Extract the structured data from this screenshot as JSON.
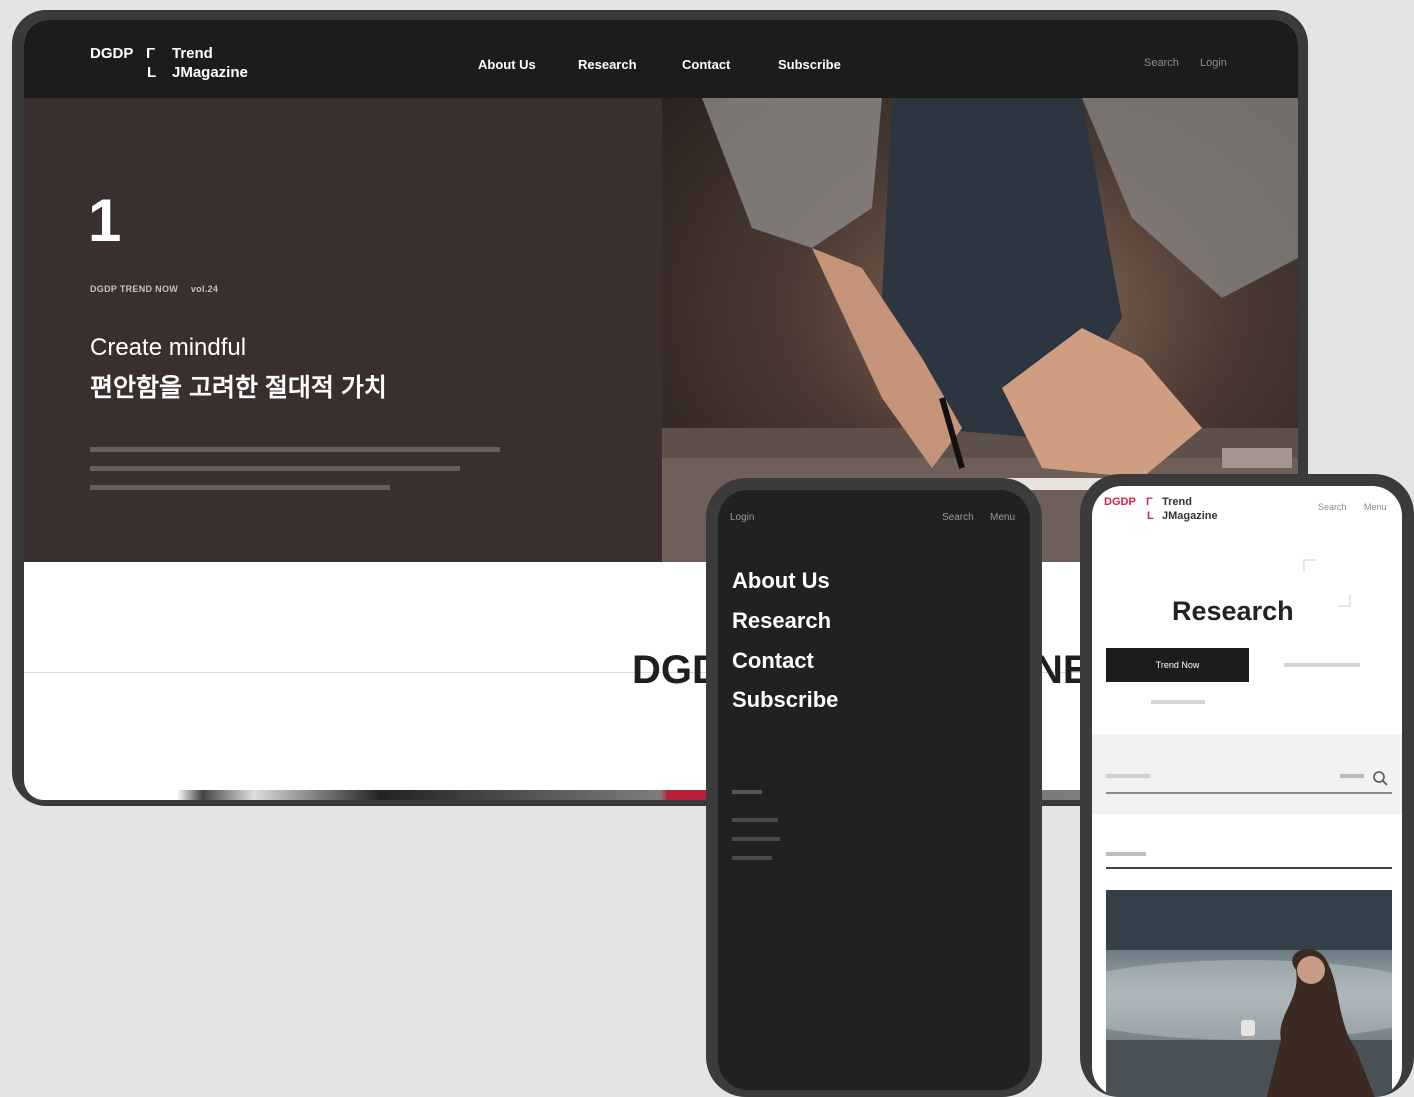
{
  "desktop": {
    "header": {
      "logo_left": "DGDP",
      "logo_bracket_open": "Γ",
      "logo_bracket_close": "L",
      "logo_line1": "Trend",
      "logo_line2": "JMagazine",
      "nav": [
        "About Us",
        "Research",
        "Contact",
        "Subscribe"
      ],
      "search": "Search",
      "login": "Login"
    },
    "hero": {
      "number": "1",
      "kicker": "DGDP TREND NOW",
      "volume": "vol.24",
      "title_en": "Create mindful",
      "title_ko": "편안함을 고려한 절대적 가치"
    },
    "section_word_left": "DGD",
    "section_word_right": "NE"
  },
  "phone_menu": {
    "login": "Login",
    "search": "Search",
    "menu": "Menu",
    "items": [
      "About Us",
      "Research",
      "Contact",
      "Subscribe"
    ]
  },
  "phone_research": {
    "logo_left": "DGDP",
    "logo_bracket_open": "Γ",
    "logo_bracket_close": "L",
    "logo_line1": "Trend",
    "logo_line2": "JMagazine",
    "search": "Search",
    "menu": "Menu",
    "title": "Research",
    "tab_active": "Trend Now"
  },
  "colors": {
    "accent_red": "#d41f3c",
    "hero_brown": "#3a2f2e",
    "dark_bg": "#212121",
    "device_frame": "#3b3b3b"
  },
  "icons": [
    "search-icon"
  ]
}
